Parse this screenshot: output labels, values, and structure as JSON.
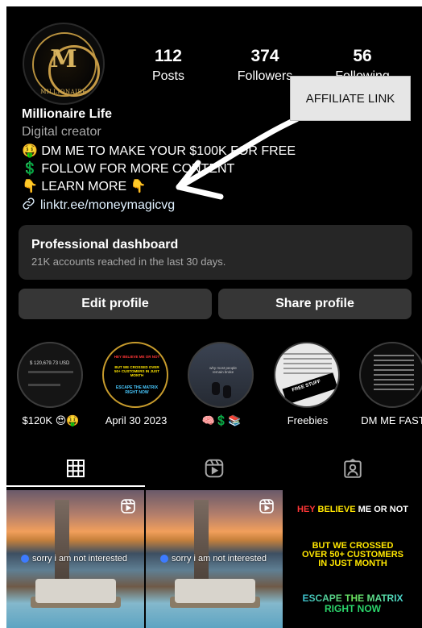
{
  "profile": {
    "avatar_letter": "M",
    "avatar_brand": "MILLIONAIRE",
    "name": "Millionaire Life",
    "category": "Digital creator",
    "bio": [
      "🤑 DM ME TO MAKE YOUR $100K FOR FREE",
      "💲 FOLLOW FOR MORE CONTENT",
      "👇 LEARN MORE 👇"
    ],
    "link": "linktr.ee/moneymagicvg"
  },
  "stats": [
    {
      "value": "112",
      "label": "Posts"
    },
    {
      "value": "374",
      "label": "Followers"
    },
    {
      "value": "56",
      "label": "Following"
    }
  ],
  "annotation": {
    "label": "AFFILIATE LINK"
  },
  "dashboard": {
    "title": "Professional dashboard",
    "subtitle": "21K accounts reached in the last 30 days."
  },
  "buttons": {
    "edit": "Edit profile",
    "share": "Share profile"
  },
  "highlights": [
    {
      "label": "$120K 😍🤑",
      "thumb": "$ 120,679.73 USD"
    },
    {
      "label": "April 30 2023",
      "thumb_top": "HEY BELIEVE ME OR NOT",
      "thumb_mid": "BUT WE CROSSED OVER 50+ CUSTOMERS IN JUST MONTH",
      "thumb_bottom": "ESCAPE THE MATRIX RIGHT NOW"
    },
    {
      "label": "🧠💲📚",
      "thumb": "why most people remain broke"
    },
    {
      "label": "Freebies",
      "thumb": "FREE STUFF"
    },
    {
      "label": "DM ME FAST",
      "thumb": ""
    }
  ],
  "tabs": [
    {
      "icon": "grid-icon"
    },
    {
      "icon": "reels-icon"
    },
    {
      "icon": "tagged-icon"
    }
  ],
  "posts": [
    {
      "caption": "sorry i am not interested"
    },
    {
      "caption": "sorry i am not interested"
    },
    {
      "line1_a": "HEY ",
      "line1_b": "BELIEVE",
      "line1_c": " ME OR NOT",
      "line2": "BUT WE CROSSED OVER 50+ CUSTOMERS IN JUST MONTH",
      "line3_a": "ESCAPE THE MATRIX",
      "line3_b": "RIGHT NOW"
    }
  ],
  "colors": {
    "background": "#000000",
    "card": "#262626",
    "button": "#363636",
    "muted": "#a8a8a8",
    "link": "#e0f1ff",
    "avatar_gold": "#c69b46"
  }
}
